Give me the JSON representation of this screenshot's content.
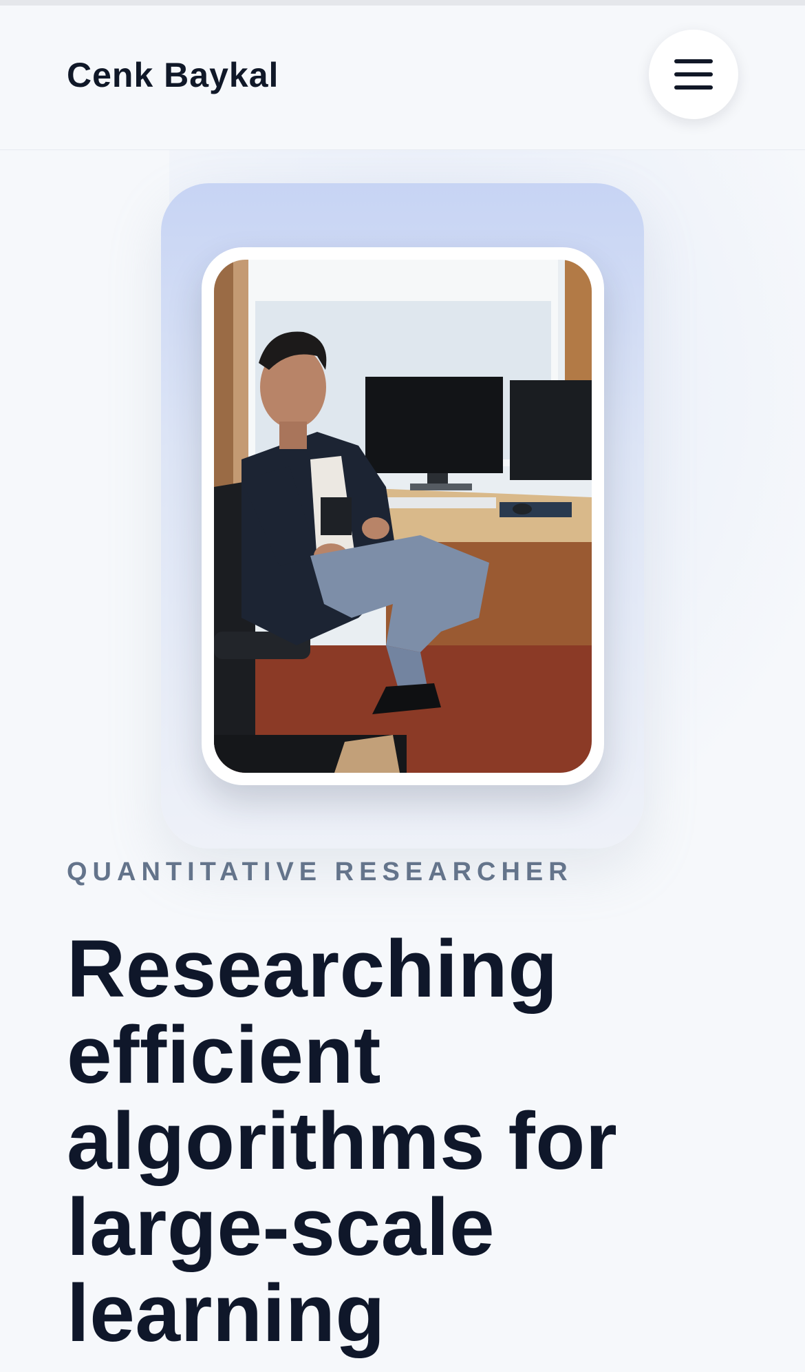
{
  "header": {
    "brand": "Cenk Baykal",
    "menu_icon": "hamburger-menu-icon"
  },
  "hero": {
    "portrait_alt": "Portrait photo of a man in a dark jacket seated in an office chair beside a desk with two monitors",
    "eyebrow": "QUANTITATIVE RESEARCHER",
    "headline_lines": [
      "Researching",
      "efficient",
      "algorithms for",
      "large-scale",
      "learning"
    ]
  },
  "colors": {
    "page_background": "#f6f8fb",
    "text_primary": "#0f172a",
    "eyebrow_text": "#64748b",
    "backdrop_top": "#c7d4f4"
  }
}
